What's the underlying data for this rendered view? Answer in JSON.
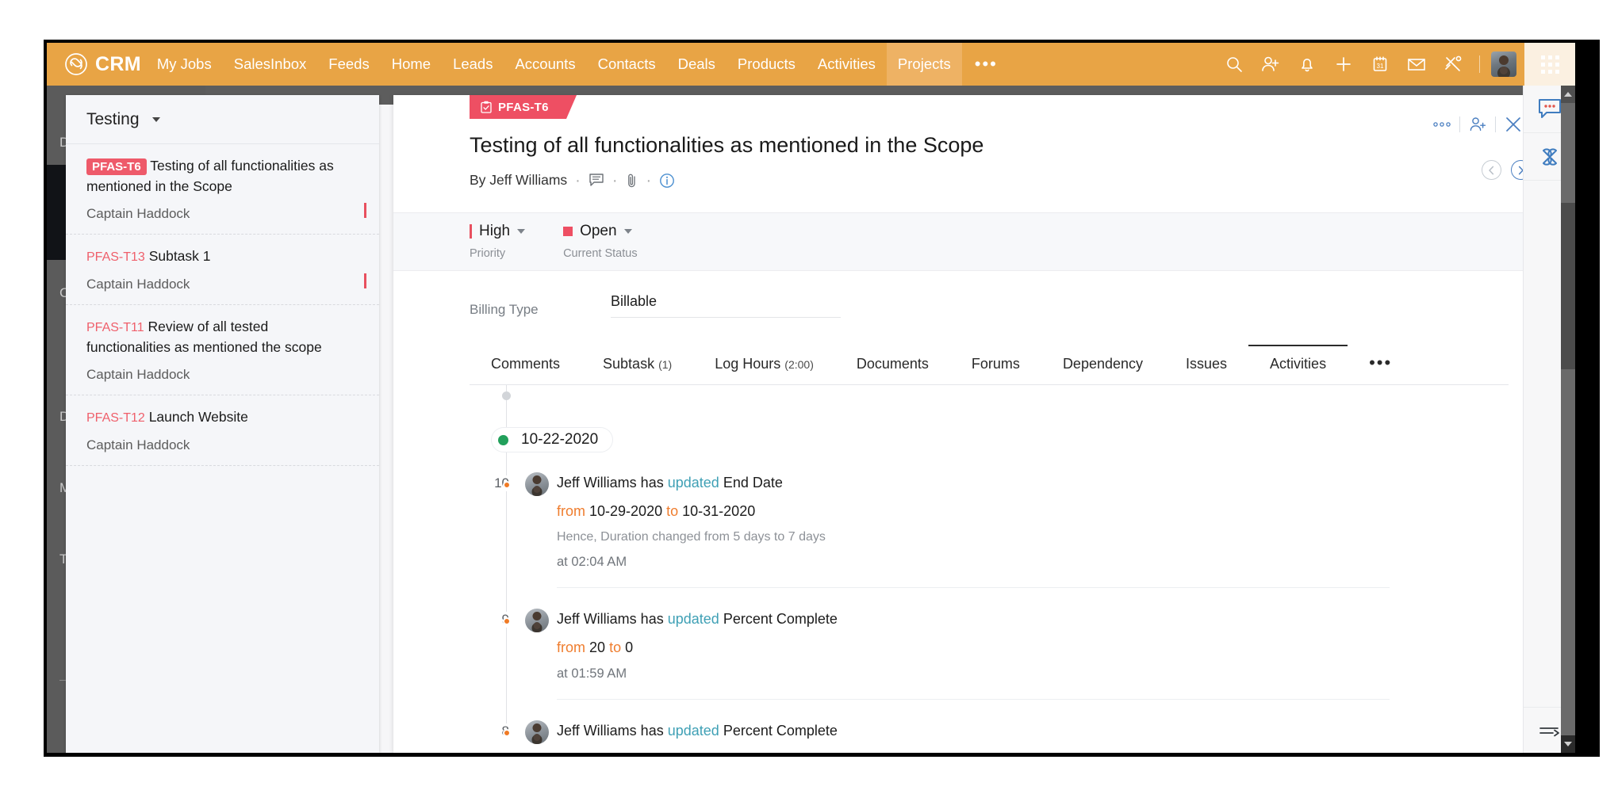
{
  "topnav": {
    "brand": "CRM",
    "brand_icon": "infinity-loop-logo",
    "items": [
      {
        "label": "My Jobs",
        "active": false
      },
      {
        "label": "SalesInbox",
        "active": false
      },
      {
        "label": "Feeds",
        "active": false
      },
      {
        "label": "Home",
        "active": false
      },
      {
        "label": "Leads",
        "active": false
      },
      {
        "label": "Accounts",
        "active": false
      },
      {
        "label": "Contacts",
        "active": false
      },
      {
        "label": "Deals",
        "active": false
      },
      {
        "label": "Products",
        "active": false
      },
      {
        "label": "Activities",
        "active": false
      },
      {
        "label": "Projects",
        "active": true
      }
    ],
    "overflow": "•••",
    "right_icons": [
      "search-icon",
      "add-user-icon",
      "bell-icon",
      "plus-icon",
      "calendar-icon",
      "envelope-icon",
      "tools-icon"
    ],
    "calendar_day": "31",
    "accent_color": "#e8a445",
    "active_tab_color": "#eeb264"
  },
  "behind_sidebar": {
    "visible_letters": [
      "D",
      "C",
      "D",
      "M",
      "T"
    ]
  },
  "list_panel": {
    "title": "Testing",
    "caret_icon": "chevron-down-icon",
    "tasks": [
      {
        "id": "PFAS-T6",
        "id_is_badge": true,
        "name": "Testing of all functionalities as mentioned in the Scope",
        "owner": "Captain Haddock",
        "has_priority_bar": true
      },
      {
        "id": "PFAS-T13",
        "id_is_badge": false,
        "name": "Subtask 1",
        "owner": "Captain Haddock",
        "has_priority_bar": true
      },
      {
        "id": "PFAS-T11",
        "id_is_badge": false,
        "name": "Review of all tested functionalities as mentioned the scope",
        "owner": "Captain Haddock",
        "has_priority_bar": false
      },
      {
        "id": "PFAS-T12",
        "id_is_badge": false,
        "name": "Launch Website",
        "owner": "Captain Haddock",
        "has_priority_bar": false
      }
    ]
  },
  "detail": {
    "id_badge": "PFAS-T6",
    "id_badge_icon": "clipboard-check-icon",
    "title": "Testing of all functionalities as mentioned in the Scope",
    "byline": "By Jeff Williams",
    "byline_icons": [
      "comment-icon",
      "attachment-icon",
      "info-icon"
    ],
    "top_controls": [
      "more-options-icon",
      "add-user-icon",
      "close-icon"
    ],
    "nav_prev_icon": "chevron-left-icon",
    "nav_next_icon": "chevron-right-icon",
    "priority": {
      "value": "High",
      "label": "Priority",
      "color": "#e8505f"
    },
    "status": {
      "value": "Open",
      "label": "Current Status",
      "color": "#ee4f63"
    },
    "billing": {
      "label": "Billing Type",
      "value": "Billable"
    },
    "tabs": [
      {
        "label": "Comments",
        "count": "",
        "active": false
      },
      {
        "label": "Subtask",
        "count": "(1)",
        "active": false
      },
      {
        "label": "Log Hours",
        "count": "(2:00)",
        "active": false
      },
      {
        "label": "Documents",
        "count": "",
        "active": false
      },
      {
        "label": "Forums",
        "count": "",
        "active": false
      },
      {
        "label": "Dependency",
        "count": "",
        "active": false
      },
      {
        "label": "Issues",
        "count": "",
        "active": false
      },
      {
        "label": "Activities",
        "count": "",
        "active": true
      }
    ],
    "tabs_overflow": "•••"
  },
  "activities": {
    "date_group": "10-22-2020",
    "items": [
      {
        "num": "10",
        "actor": "Jeff Williams has",
        "action": "updated",
        "field": "End Date",
        "change_prefix": "from",
        "from_value": "10-29-2020",
        "change_mid": "to",
        "to_value": "10-31-2020",
        "note": "Hence, Duration changed from 5 days to 7 days",
        "time": "at 02:04 AM"
      },
      {
        "num": "9",
        "actor": "Jeff Williams has",
        "action": "updated",
        "field": "Percent Complete",
        "change_prefix": "from",
        "from_value": "20",
        "change_mid": "to",
        "to_value": "0",
        "note": "",
        "time": "at 01:59 AM"
      },
      {
        "num": "8",
        "actor": "Jeff Williams has",
        "action": "updated",
        "field": "Percent Complete",
        "change_prefix": "",
        "from_value": "",
        "change_mid": "",
        "to_value": "",
        "note": "",
        "time": ""
      }
    ]
  },
  "right_rail": {
    "icons": [
      "chat-bubble-icon",
      "clover-icon"
    ],
    "bottom_icon": "collapse-panel-icon"
  }
}
